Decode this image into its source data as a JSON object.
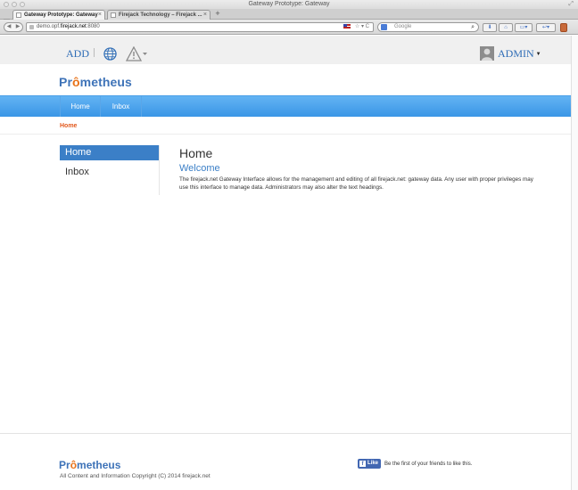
{
  "browser": {
    "window_title": "Gateway Prototype: Gateway",
    "tabs": [
      {
        "label": "Gateway Prototype: Gateway",
        "active": true
      },
      {
        "label": "Firejack Technology – Firejack ...",
        "active": false
      }
    ],
    "newtab_glyph": "+",
    "close_glyph": "×",
    "url": {
      "prefix": "demo.opf.",
      "host": "firejack.net",
      "suffix": ":8080"
    },
    "search": {
      "placeholder": "Google"
    }
  },
  "header": {
    "add_label": "ADD",
    "admin_label": "ADMIN",
    "icons": [
      "globe-icon",
      "warning-icon",
      "avatar"
    ]
  },
  "brand": {
    "logo_pre": "Pr",
    "logo_flame": "ô",
    "logo_post": "metheus",
    "accent_color": "#3e73b8",
    "flame_color": "#e8731a"
  },
  "menu": {
    "items": [
      {
        "label": "Home"
      },
      {
        "label": "Inbox"
      }
    ],
    "bar_color": "#4aa3ec"
  },
  "breadcrumb": {
    "current": "Home",
    "color": "#e2581c"
  },
  "sidenav": {
    "items": [
      {
        "label": "Home",
        "active": true
      },
      {
        "label": "Inbox",
        "active": false
      }
    ]
  },
  "content": {
    "title": "Home",
    "subtitle": "Welcome",
    "body": "The firejack.net Gateway Interface allows for the management and editing of all firejack.net: gateway data. Any user with proper privileges may use this interface to manage data. Administrators may also alter the text headings."
  },
  "footer": {
    "copyright": "All Content and Information Copyright (C) 2014 firejack.net",
    "fb_like_label": "Like",
    "fb_text": "Be the first of your friends to like this."
  }
}
